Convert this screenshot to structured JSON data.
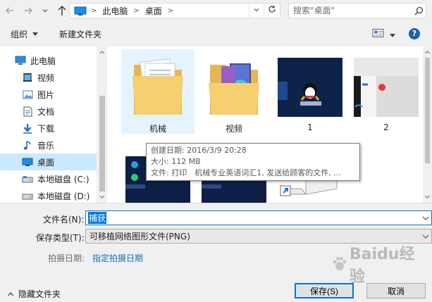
{
  "nav": {
    "back_icon": "arrow-left-icon",
    "forward_icon": "arrow-right-icon",
    "recent_icon": "chevron-down-icon",
    "up_icon": "arrow-up-icon",
    "breadcrumb": [
      "此电脑",
      "桌面"
    ],
    "refresh_icon": "refresh-icon",
    "search_placeholder": "搜索\"桌面\"",
    "search_icon": "search-icon"
  },
  "toolbar": {
    "organize_label": "组织",
    "new_folder_label": "新建文件夹",
    "view_icon": "view-options-icon",
    "help_label": "?"
  },
  "sidebar": {
    "items": [
      {
        "label": "此电脑",
        "icon": "computer-icon",
        "selected": false
      },
      {
        "label": "视频",
        "icon": "video-icon",
        "selected": false
      },
      {
        "label": "图片",
        "icon": "picture-icon",
        "selected": false
      },
      {
        "label": "文档",
        "icon": "document-icon",
        "selected": false
      },
      {
        "label": "下载",
        "icon": "download-icon",
        "selected": false
      },
      {
        "label": "音乐",
        "icon": "music-icon",
        "selected": false
      },
      {
        "label": "桌面",
        "icon": "desktop-icon",
        "selected": true
      },
      {
        "label": "本地磁盘 (C:)",
        "icon": "drive-icon",
        "selected": false
      },
      {
        "label": "本地磁盘 (D:)",
        "icon": "drive-icon",
        "selected": false
      }
    ]
  },
  "files": [
    {
      "name": "机械",
      "kind": "folder"
    },
    {
      "name": "视频",
      "kind": "folder"
    },
    {
      "name": "1",
      "kind": "image"
    },
    {
      "name": "2",
      "kind": "image"
    },
    {
      "name": "",
      "kind": "image"
    },
    {
      "name": "",
      "kind": "image"
    },
    {
      "name": "",
      "kind": "image"
    }
  ],
  "tooltip": {
    "created": "创建日期: 2016/3/9 20:28",
    "size": "大小: 112 MB",
    "files": "文件: 打印　机械专业英语词汇1, 发送给顾客的文件, ..."
  },
  "form": {
    "filename_label": "文件名(N):",
    "filename_value": "捕获",
    "filetype_label": "保存类型(T):",
    "filetype_value": "可移植网络图形文件(PNG)",
    "date_label": "拍摄日期:",
    "date_link": "指定拍摄日期"
  },
  "footer": {
    "hide_folders_label": "隐藏文件夹",
    "save_label": "保存(S)",
    "cancel_label": "取消"
  },
  "watermark": "Baidu经验",
  "colors": {
    "selection": "#cce8ff",
    "hover": "#e5f3ff",
    "link": "#1a6cb5",
    "folder": "#f3c969",
    "primary_border": "#0078d7"
  }
}
